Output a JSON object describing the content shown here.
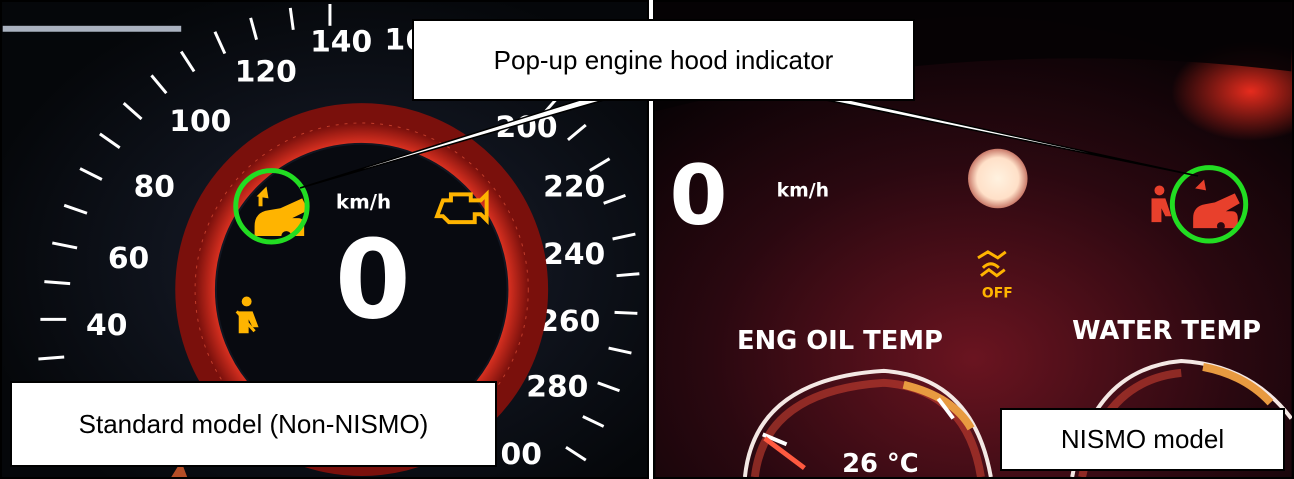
{
  "callout": {
    "text": "Pop-up engine hood indicator"
  },
  "left_panel": {
    "label": "Standard model (Non-NISMO)",
    "speed_unit": "km/h",
    "speed_value": "0",
    "scale_labels": {
      "s40": "40",
      "s60": "60",
      "s80": "80",
      "s100": "100",
      "s120": "120",
      "s140": "140",
      "s160": "16",
      "s200": "200",
      "s220": "220",
      "s240": "240",
      "s260": "260",
      "s280": "280",
      "s300": "00"
    }
  },
  "right_panel": {
    "label": "NISMO model",
    "speed_unit": "km/h",
    "speed_value": "0",
    "eng_oil_title": "ENG OIL TEMP",
    "water_title": "WATER TEMP",
    "oil_temp_value": "26 °C",
    "vdc_off_text": "OFF"
  },
  "colors": {
    "highlight_circle": "#22dd22",
    "warning_amber": "#ffb400",
    "warning_red": "#e8402c",
    "ring_red": "#c82418"
  }
}
